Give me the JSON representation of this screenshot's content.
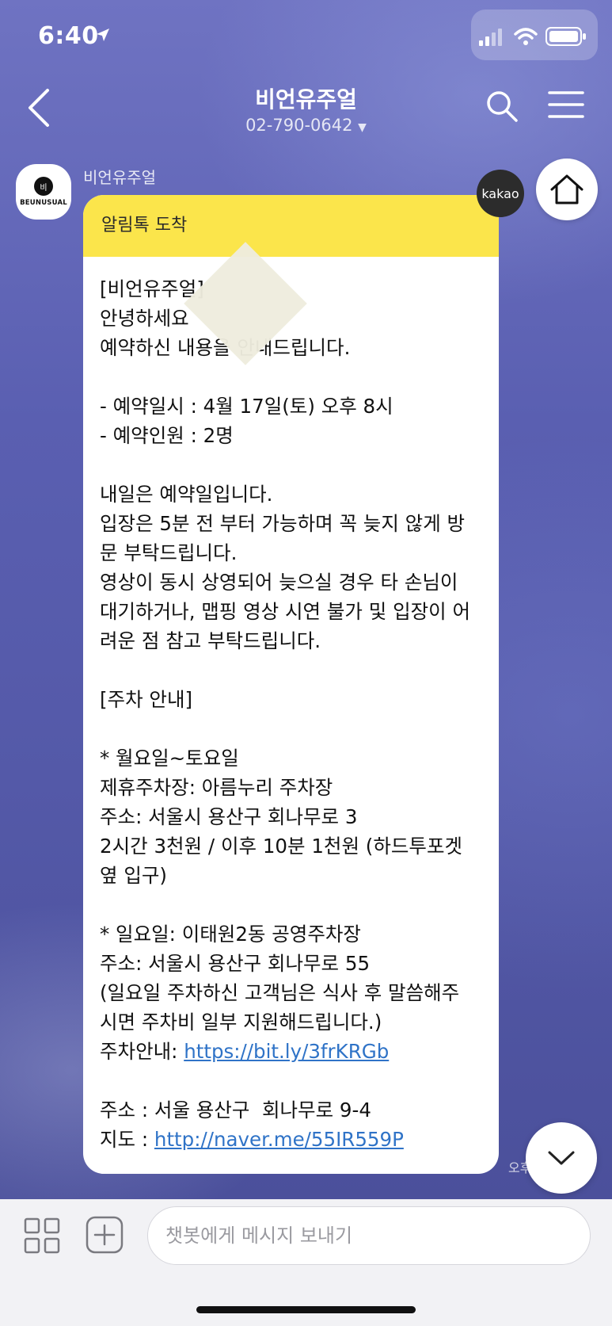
{
  "status_bar": {
    "time": "6:40"
  },
  "header": {
    "title": "비언유주얼",
    "phone": "02-790-0642"
  },
  "sender": {
    "name": "비언유주얼",
    "avatar_text": "BEUNUSUAL",
    "avatar_mark": "비"
  },
  "kakao_badge": "kakao",
  "message": {
    "header": "알림톡 도착",
    "body_intro": "[비언유주얼]\n안녕하세요 \n예약하신 내용을 안내드립니다.\n\n- 예약일시 : 4월 17일(토) 오후 8시\n- 예약인원 : 2명\n\n내일은 예약일입니다.\n입장은 5분 전 부터 가능하며 꼭 늦지 않게 방\n문 부탁드립니다.\n영상이 동시 상영되어 늦으실 경우 타 손님이\n대기하거나, 맵핑 영상 시연 불가 및 입장이 어\n려운 점 참고 부탁드립니다.\n\n[주차 안내]\n\n* 월요일~토요일\n제휴주차장: 아름누리 주차장\n주소: 서울시 용산구 회나무로 3\n2시간 3천원 / 이후 10분 1천원 (하드투포겟\n옆 입구)\n\n* 일요일: 이태원2동 공영주차장\n주소: 서울시 용산구 회나무로 55\n(일요일 주차하신 고객님은 식사 후 말씀해주\n시면 주차비 일부 지원해드립니다.)\n",
    "parking_link_label": "주차안내: ",
    "parking_link": "https://bit.ly/3frKRGb",
    "address_line": "\n\n주소 : 서울 용산구  회나무로 9-4\n",
    "map_link_label": "지도 : ",
    "map_link": "http://naver.me/55IR559P",
    "time": "오후"
  },
  "input": {
    "placeholder": "챗봇에게 메시지 보내기"
  },
  "colors": {
    "bubble_header": "#fbe54b",
    "link": "#2f73c7",
    "chat_background": "#5a5fb1"
  }
}
